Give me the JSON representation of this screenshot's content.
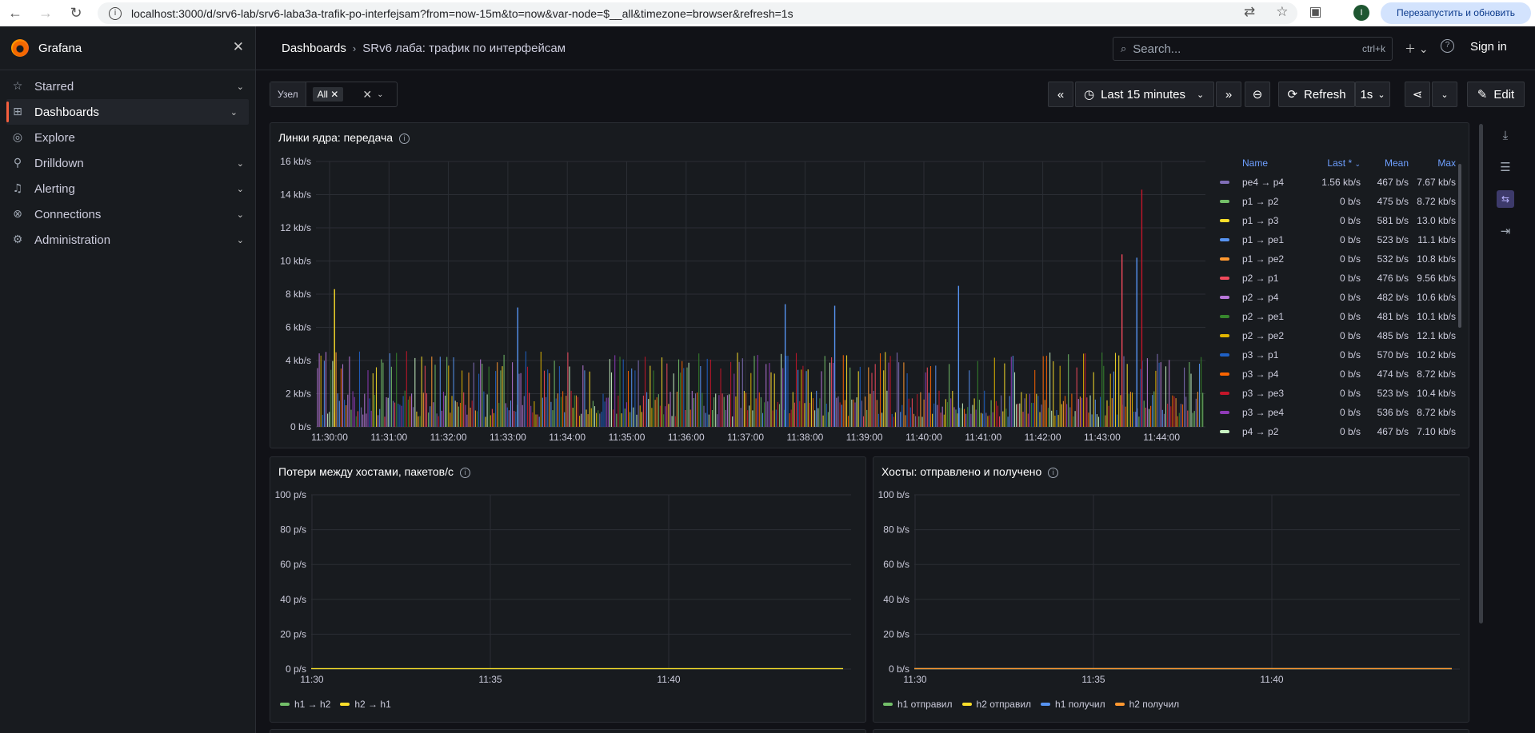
{
  "browser": {
    "url": "localhost:3000/d/srv6-lab/srv6-laba3a-trafik-po-interfejsam?from=now-15m&to=now&var-node=$__all&timezone=browser&refresh=1s",
    "restart_label": "Перезапустить и обновить",
    "avatar_letter": "I"
  },
  "app": {
    "name": "Grafana"
  },
  "sidebar": {
    "items": [
      {
        "label": "Starred",
        "icon": "star-icon"
      },
      {
        "label": "Dashboards",
        "icon": "grid-icon"
      },
      {
        "label": "Explore",
        "icon": "compass-icon"
      },
      {
        "label": "Drilldown",
        "icon": "drilldown-icon"
      },
      {
        "label": "Alerting",
        "icon": "bell-icon"
      },
      {
        "label": "Connections",
        "icon": "connections-icon"
      },
      {
        "label": "Administration",
        "icon": "gear-icon"
      }
    ]
  },
  "header": {
    "breadcrumb_root": "Dashboards",
    "breadcrumb_current": "SRv6 лаба: трафик по интерфейсам",
    "search_placeholder": "Search...",
    "search_shortcut": "ctrl+k",
    "signin": "Sign in"
  },
  "toolbar": {
    "var_label": "Узел",
    "var_value": "All",
    "time_range": "Last 15 minutes",
    "refresh_label": "Refresh",
    "refresh_interval": "1s",
    "edit_label": "Edit"
  },
  "colors": {
    "green": "#73bf69",
    "yellow": "#fade2a",
    "blue": "#5794f2",
    "orange": "#ff9830",
    "red": "#f2495c",
    "purple": "#b877d9",
    "darkgreen": "#37872d",
    "darkyellow": "#e0b400",
    "darkblue": "#1f60c4",
    "darkorange": "#fa6400",
    "darkred": "#c4162a",
    "darkpurple": "#8f3bb8",
    "lightgreen": "#c8f2c2",
    "lavender": "#806eb7"
  },
  "panels": {
    "main": {
      "title": "Линки ядра: передача",
      "legend_headers": {
        "name": "Name",
        "last": "Last *",
        "mean": "Mean",
        "max": "Max"
      },
      "legend_rows": [
        {
          "name": "pe4 → p4",
          "last": "1.56 kb/s",
          "mean": "467 b/s",
          "max": "7.67 kb/s",
          "color": "#806eb7"
        },
        {
          "name": "p1 → p2",
          "last": "0 b/s",
          "mean": "475 b/s",
          "max": "8.72 kb/s",
          "color": "#73bf69"
        },
        {
          "name": "p1 → p3",
          "last": "0 b/s",
          "mean": "581 b/s",
          "max": "13.0 kb/s",
          "color": "#fade2a"
        },
        {
          "name": "p1 → pe1",
          "last": "0 b/s",
          "mean": "523 b/s",
          "max": "11.1 kb/s",
          "color": "#5794f2"
        },
        {
          "name": "p1 → pe2",
          "last": "0 b/s",
          "mean": "532 b/s",
          "max": "10.8 kb/s",
          "color": "#ff9830"
        },
        {
          "name": "p2 → p1",
          "last": "0 b/s",
          "mean": "476 b/s",
          "max": "9.56 kb/s",
          "color": "#f2495c"
        },
        {
          "name": "p2 → p4",
          "last": "0 b/s",
          "mean": "482 b/s",
          "max": "10.6 kb/s",
          "color": "#b877d9"
        },
        {
          "name": "p2 → pe1",
          "last": "0 b/s",
          "mean": "481 b/s",
          "max": "10.1 kb/s",
          "color": "#37872d"
        },
        {
          "name": "p2 → pe2",
          "last": "0 b/s",
          "mean": "485 b/s",
          "max": "12.1 kb/s",
          "color": "#e0b400"
        },
        {
          "name": "p3 → p1",
          "last": "0 b/s",
          "mean": "570 b/s",
          "max": "10.2 kb/s",
          "color": "#1f60c4"
        },
        {
          "name": "p3 → p4",
          "last": "0 b/s",
          "mean": "474 b/s",
          "max": "8.72 kb/s",
          "color": "#fa6400"
        },
        {
          "name": "p3 → pe3",
          "last": "0 b/s",
          "mean": "523 b/s",
          "max": "10.4 kb/s",
          "color": "#c4162a"
        },
        {
          "name": "p3 → pe4",
          "last": "0 b/s",
          "mean": "536 b/s",
          "max": "8.72 kb/s",
          "color": "#8f3bb8"
        },
        {
          "name": "p4 → p2",
          "last": "0 b/s",
          "mean": "467 b/s",
          "max": "7.10 kb/s",
          "color": "#c8f2c2"
        }
      ]
    },
    "losses": {
      "title": "Потери между хостами, пакетов/с",
      "legend": [
        {
          "name": "h1 → h2",
          "color": "#73bf69"
        },
        {
          "name": "h2 → h1",
          "color": "#fade2a"
        }
      ]
    },
    "hosts": {
      "title": "Хосты: отправлено и получено",
      "legend": [
        {
          "name": "h1 отправил",
          "color": "#73bf69"
        },
        {
          "name": "h2 отправил",
          "color": "#fade2a"
        },
        {
          "name": "h1 получил",
          "color": "#5794f2"
        },
        {
          "name": "h2 получил",
          "color": "#ff9830"
        }
      ]
    }
  },
  "chart_data": [
    {
      "type": "line",
      "title": "Линки ядра: передача",
      "x_ticks": [
        "11:30:00",
        "11:31:00",
        "11:32:00",
        "11:33:00",
        "11:34:00",
        "11:35:00",
        "11:36:00",
        "11:37:00",
        "11:38:00",
        "11:39:00",
        "11:40:00",
        "11:41:00",
        "11:42:00",
        "11:43:00",
        "11:44:00"
      ],
      "y_ticks": [
        "0 b/s",
        "2 kb/s",
        "4 kb/s",
        "6 kb/s",
        "8 kb/s",
        "10 kb/s",
        "12 kb/s",
        "14 kb/s",
        "16 kb/s"
      ],
      "ylim": [
        0,
        16
      ],
      "y_unit": "kb/s",
      "grid": true,
      "legend_placement": "right",
      "series_names": [
        "pe4 → p4",
        "p1 → p2",
        "p1 → p3",
        "p1 → pe1",
        "p1 → pe2",
        "p2 → p1",
        "p2 → p4",
        "p2 → pe1",
        "p2 → pe2",
        "p3 → p1",
        "p3 → p4",
        "p3 → pe3",
        "p3 → pe4",
        "p4 → p2"
      ],
      "peaks": [
        {
          "x": "11:30:05",
          "y": 8.3
        },
        {
          "x": "11:33:10",
          "y": 7.2
        },
        {
          "x": "11:37:40",
          "y": 7.4
        },
        {
          "x": "11:38:30",
          "y": 7.3
        },
        {
          "x": "11:40:35",
          "y": 8.5
        },
        {
          "x": "11:43:20",
          "y": 10.4
        },
        {
          "x": "11:43:35",
          "y": 10.2
        },
        {
          "x": "11:43:40",
          "y": 14.3
        }
      ]
    },
    {
      "type": "line",
      "title": "Потери между хостами, пакетов/с",
      "x_ticks": [
        "11:30",
        "11:35",
        "11:40"
      ],
      "y_ticks": [
        "0 p/s",
        "20 p/s",
        "40 p/s",
        "60 p/s",
        "80 p/s",
        "100 p/s"
      ],
      "ylim": [
        0,
        100
      ],
      "grid": true,
      "legend_placement": "bottom",
      "series": [
        {
          "name": "h1 → h2",
          "values": [
            0,
            0
          ]
        },
        {
          "name": "h2 → h1",
          "values": [
            0,
            0
          ]
        }
      ]
    },
    {
      "type": "line",
      "title": "Хосты: отправлено и получено",
      "x_ticks": [
        "11:30",
        "11:35",
        "11:40"
      ],
      "y_ticks": [
        "0 b/s",
        "20 b/s",
        "40 b/s",
        "60 b/s",
        "80 b/s",
        "100 b/s"
      ],
      "ylim": [
        0,
        100
      ],
      "grid": true,
      "legend_placement": "bottom",
      "series": [
        {
          "name": "h1 отправил",
          "values": [
            0,
            0
          ]
        },
        {
          "name": "h2 отправил",
          "values": [
            0,
            0
          ]
        },
        {
          "name": "h1 получил",
          "values": [
            0,
            0
          ]
        },
        {
          "name": "h2 получил",
          "values": [
            0,
            0
          ]
        }
      ]
    }
  ]
}
